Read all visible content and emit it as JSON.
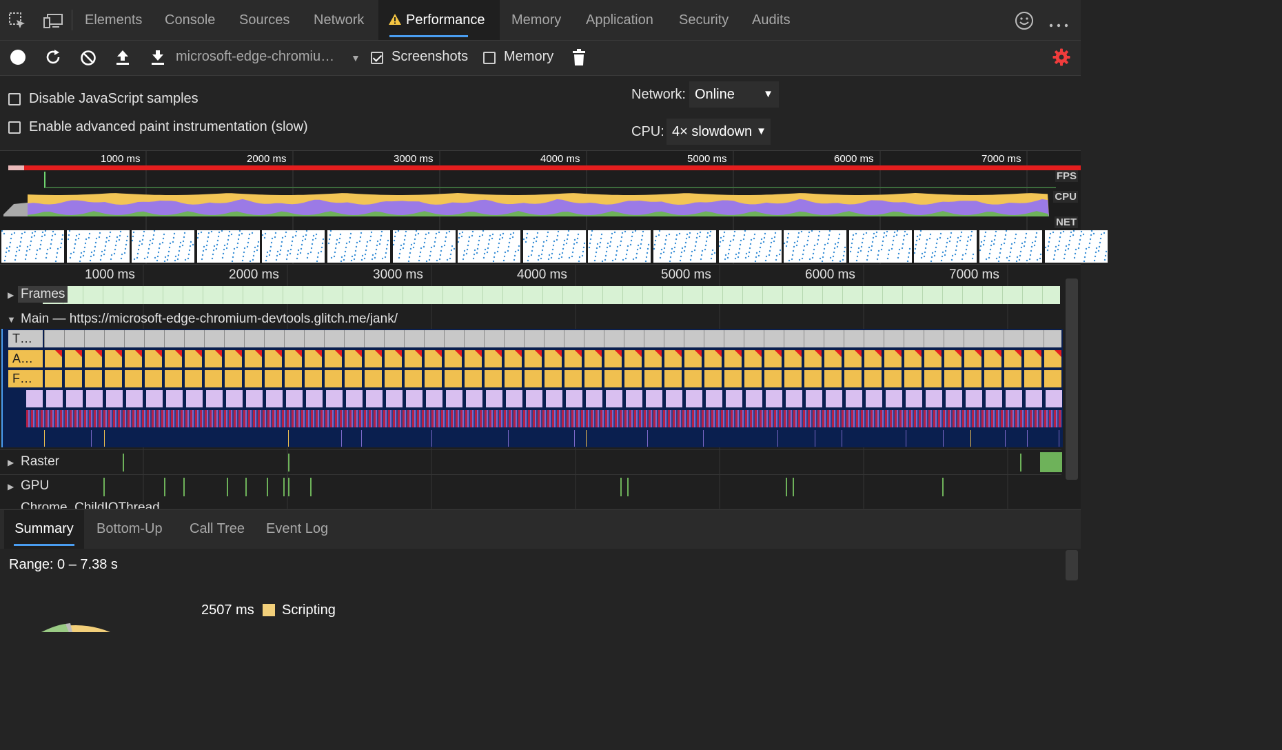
{
  "tabs": [
    {
      "label": "Elements",
      "active": false
    },
    {
      "label": "Console",
      "active": false
    },
    {
      "label": "Sources",
      "active": false
    },
    {
      "label": "Network",
      "active": false
    },
    {
      "label": "Performance",
      "active": true,
      "warning": true
    },
    {
      "label": "Memory",
      "active": false
    },
    {
      "label": "Application",
      "active": false
    },
    {
      "label": "Security",
      "active": false
    },
    {
      "label": "Audits",
      "active": false
    }
  ],
  "toolbar": {
    "profile_select": "microsoft-edge-chromiu…",
    "screenshots_label": "Screenshots",
    "screenshots_checked": true,
    "memory_label": "Memory",
    "memory_checked": false
  },
  "settings": {
    "disable_js_samples": "Disable JavaScript samples",
    "advanced_paint": "Enable advanced paint instrumentation (slow)",
    "network_label": "Network:",
    "network_value": "Online",
    "cpu_label": "CPU:",
    "cpu_value": "4× slowdown"
  },
  "overview": {
    "ticks": [
      "1000 ms",
      "2000 ms",
      "3000 ms",
      "4000 ms",
      "5000 ms",
      "6000 ms",
      "7000 ms"
    ],
    "fps_label": "FPS",
    "cpu_label": "CPU",
    "net_label": "NET"
  },
  "timeline": {
    "ticks": [
      "1000 ms",
      "2000 ms",
      "3000 ms",
      "4000 ms",
      "5000 ms",
      "6000 ms",
      "7000 ms"
    ],
    "frames_label": "Frames",
    "main_label": "Main — https://microsoft-edge-chromium-devtools.glitch.me/jank/",
    "task_labels": [
      "T…",
      "A…",
      "F…"
    ],
    "raster_label": "Raster",
    "gpu_label": "GPU",
    "next_label": "Chrome_ChildIOThread"
  },
  "bottom_tabs": [
    {
      "label": "Summary",
      "active": true
    },
    {
      "label": "Bottom-Up",
      "active": false
    },
    {
      "label": "Call Tree",
      "active": false
    },
    {
      "label": "Event Log",
      "active": false
    }
  ],
  "summary": {
    "range": "Range: 0 – 7.38 s",
    "scripting_value": "2507 ms",
    "scripting_label": "Scripting"
  },
  "colors": {
    "fps_bad": "#e41e1e",
    "cpu_scripting": "#f2c555",
    "cpu_rendering": "#9b7ae6",
    "cpu_painting": "#6eb25a",
    "frames": "#d8f2d4",
    "task": "#c8c8c8",
    "accent": "#4a9df0"
  }
}
